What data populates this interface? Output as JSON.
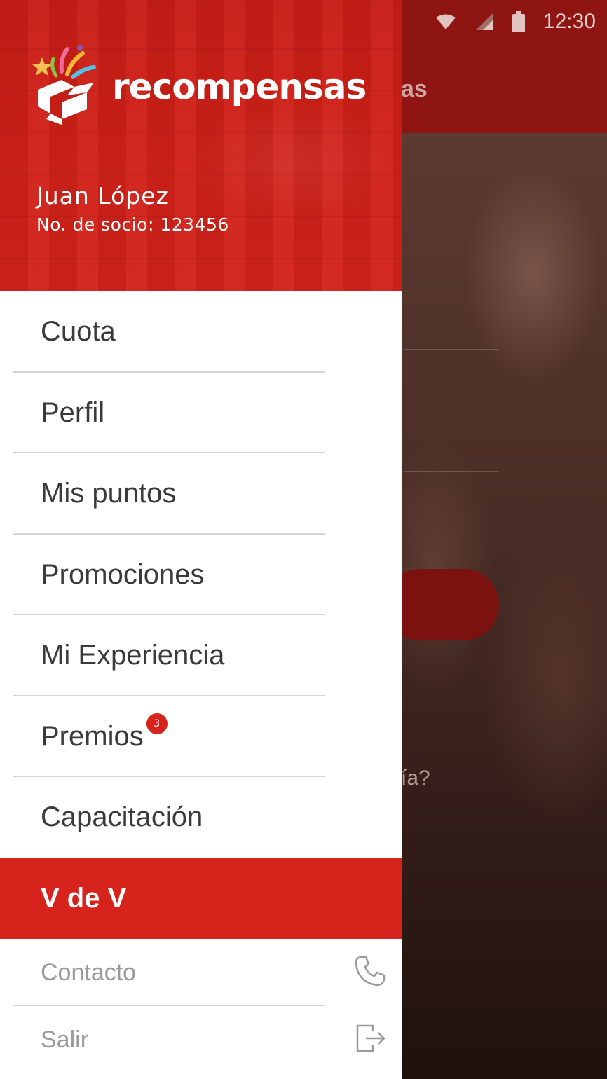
{
  "status_bar": {
    "time": "12:30"
  },
  "background_screen": {
    "title_fragment": "as",
    "question_fragment": "ía?"
  },
  "drawer": {
    "brand": "recompensas",
    "user": {
      "name": "Juan López",
      "member_number": "No. de socio: 123456"
    },
    "menu": [
      {
        "label": "Cuota"
      },
      {
        "label": "Perfil"
      },
      {
        "label": "Mis puntos"
      },
      {
        "label": "Promociones"
      },
      {
        "label": "Mi Experiencia"
      },
      {
        "label": "Premios",
        "badge": "3"
      },
      {
        "label": "Capacitación"
      },
      {
        "label": "V de V",
        "active": true
      }
    ],
    "footer": [
      {
        "label": "Contacto",
        "icon": "phone-icon"
      },
      {
        "label": "Salir",
        "icon": "logout-icon"
      }
    ]
  },
  "colors": {
    "brand_red": "#d6241c",
    "header_red": "#c81e16",
    "text": "#3a3a3a",
    "muted_text": "#9a9a9a"
  }
}
